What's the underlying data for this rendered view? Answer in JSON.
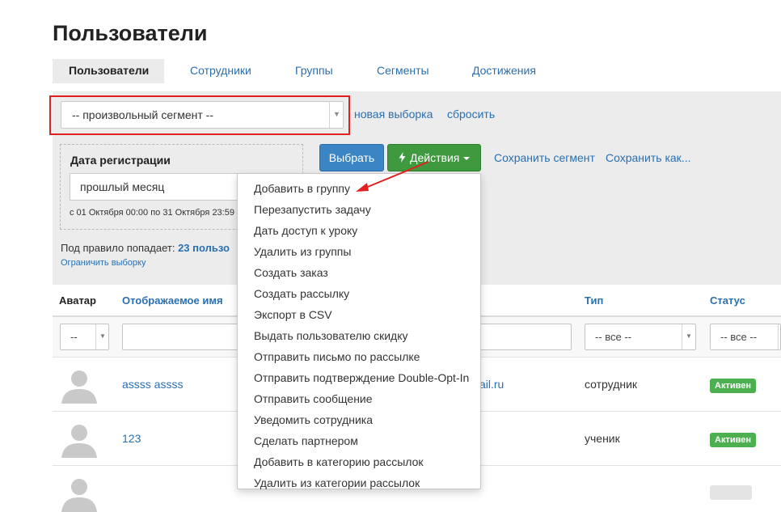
{
  "page": {
    "title": "Пользователи"
  },
  "tabs": [
    {
      "label": "Пользователи",
      "active": true
    },
    {
      "label": "Сотрудники"
    },
    {
      "label": "Группы"
    },
    {
      "label": "Сегменты"
    },
    {
      "label": "Достижения"
    }
  ],
  "segment": {
    "value": "-- произвольный сегмент --",
    "new_selection": "новая выборка",
    "reset": "сбросить"
  },
  "registration": {
    "title": "Дата регистрации",
    "value": "прошлый месяц",
    "range": "с 01 Октября 00:00 по 31 Октября 23:59"
  },
  "toolbar": {
    "select_label": "Выбрать",
    "actions_label": "Действия",
    "save_segment": "Сохранить сегмент",
    "save_as": "Сохранить как..."
  },
  "rule": {
    "prefix": "Под правило попадает:",
    "count": "23 пользо",
    "limit_link": "Ограничить выборку"
  },
  "table": {
    "columns": {
      "avatar": "Аватар",
      "display_name": "Отображаемое имя",
      "type": "Тип",
      "status": "Статус"
    },
    "filters": {
      "avatar": "--",
      "type": "-- все --",
      "status": "-- все --"
    },
    "rows": [
      {
        "name": "assss assss",
        "email_tail": "ail.ru",
        "type": "сотрудник",
        "status": "Активен"
      },
      {
        "name": "123",
        "email_tail": "",
        "type": "ученик",
        "status": "Активен"
      },
      {
        "name": "",
        "email_tail": "",
        "type": "",
        "status": ""
      }
    ]
  },
  "actions_menu": {
    "items": [
      "Добавить в группу",
      "Перезапустить задачу",
      "Дать доступ к уроку",
      "Удалить из группы",
      "Создать заказ",
      "Создать рассылку",
      "Экспорт в CSV",
      "Выдать пользователю скидку",
      "Отправить письмо по рассылке",
      "Отправить подтверждение Double-Opt-In",
      "Отправить сообщение",
      "Уведомить сотрудника",
      "Сделать партнером",
      "Добавить в категорию рассылок",
      "Удалить из категории рассылок"
    ]
  },
  "colors": {
    "accent_blue": "#2a6fb0",
    "select_button": "#3c85c4",
    "actions_button": "#3f9a3f",
    "status_active": "#4caf50",
    "highlight_red": "#e2201f"
  },
  "icons": {
    "actions": "lightning-bolt-icon",
    "dropdown": "triangle-down-icon",
    "avatar": "user-silhouette-icon",
    "annotation": "red-arrow-icon"
  }
}
